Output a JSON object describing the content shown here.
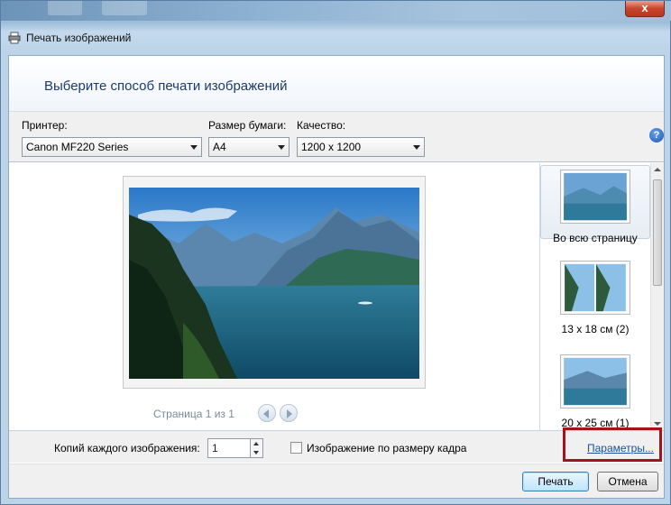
{
  "window": {
    "title": "Печать изображений",
    "close_glyph": "x"
  },
  "header": {
    "heading": "Выберите способ печати изображений"
  },
  "options": {
    "printer_label": "Принтер:",
    "printer_value": "Canon MF220 Series",
    "paper_label": "Размер бумаги:",
    "paper_value": "A4",
    "quality_label": "Качество:",
    "quality_value": "1200 x 1200",
    "help_glyph": "?"
  },
  "preview": {
    "page_info": "Страница 1 из 1"
  },
  "layouts": [
    {
      "label": "Во всю страницу",
      "selected": true
    },
    {
      "label": "13 x 18 см (2)",
      "selected": false
    },
    {
      "label": "20 x 25 см (1)",
      "selected": false
    }
  ],
  "bottom": {
    "copies_label": "Копий каждого изображения:",
    "copies_value": "1",
    "fit_label": "Изображение по размеру кадра",
    "fit_checked": false,
    "params_link": "Параметры..."
  },
  "footer": {
    "print_label": "Печать",
    "cancel_label": "Отмена"
  },
  "colors": {
    "accent_highlight": "#a3121f",
    "link": "#1b4fa6"
  }
}
